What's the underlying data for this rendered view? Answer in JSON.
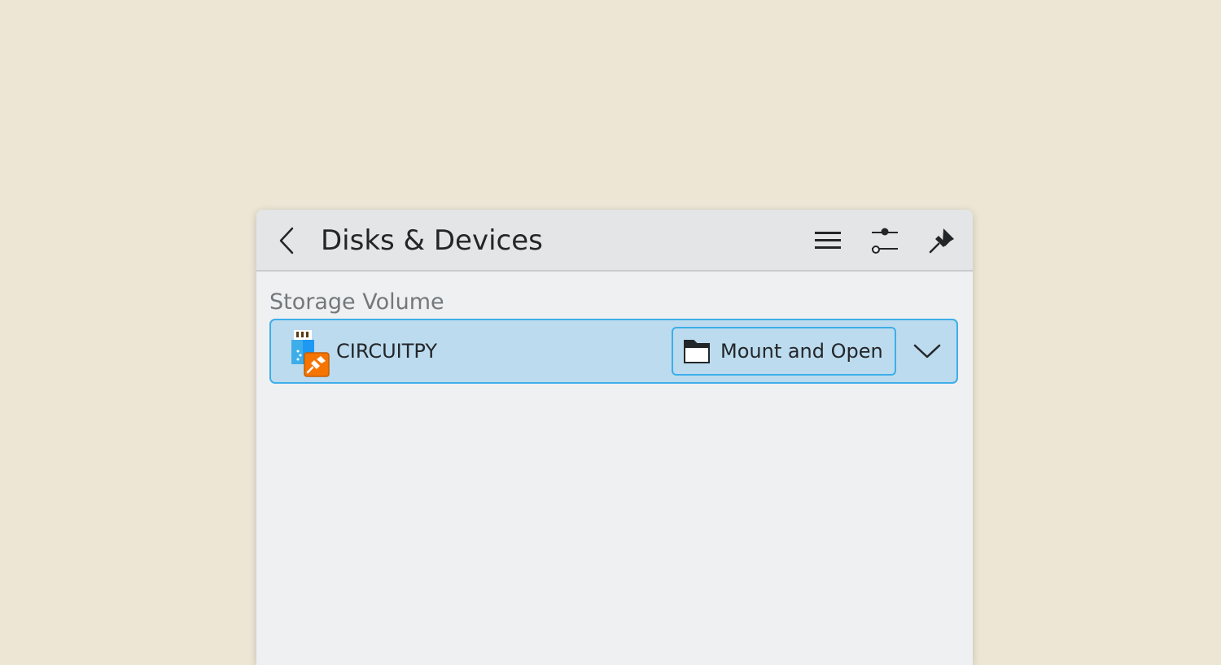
{
  "header": {
    "title": "Disks & Devices",
    "back_icon": "chevron-left-icon",
    "menu_icon": "hamburger-menu-icon",
    "settings_icon": "sliders-icon",
    "pin_icon": "pin-icon"
  },
  "section": {
    "label": "Storage Volume"
  },
  "device": {
    "name": "CIRCUITPY",
    "icon": "usb-flash-drive-icon",
    "action_label": "Mount and Open",
    "action_icon": "folder-icon",
    "expand_icon": "chevron-down-icon"
  },
  "colors": {
    "accent": "#3daee9",
    "highlight": "#bcdbee",
    "background": "#ede6d5",
    "panel": "#eff0f1",
    "header": "#e3e5e7"
  }
}
